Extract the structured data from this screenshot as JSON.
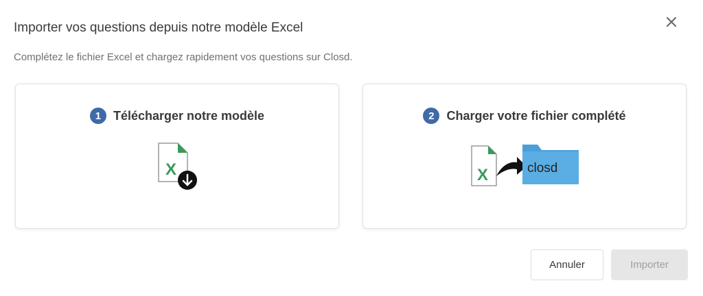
{
  "dialog": {
    "title": "Importer vos questions depuis notre modèle Excel",
    "subtitle": "Complétez le fichier Excel et chargez rapidement vos questions sur Closd.",
    "close_icon": "close-icon"
  },
  "cards": [
    {
      "step": "1",
      "title": "Télécharger notre modèle",
      "icon": "excel-file-download-icon"
    },
    {
      "step": "2",
      "title": "Charger votre fichier complété",
      "icon": "excel-to-closd-folder-icon",
      "folder_text": "closd"
    }
  ],
  "buttons": {
    "cancel_label": "Annuler",
    "import_label": "Importer",
    "import_disabled": true
  },
  "colors": {
    "step_badge": "#3f6aa8",
    "excel_green": "#3a9a5b",
    "folder_blue": "#4a9fd8",
    "disabled_bg": "#e6e6e6"
  }
}
